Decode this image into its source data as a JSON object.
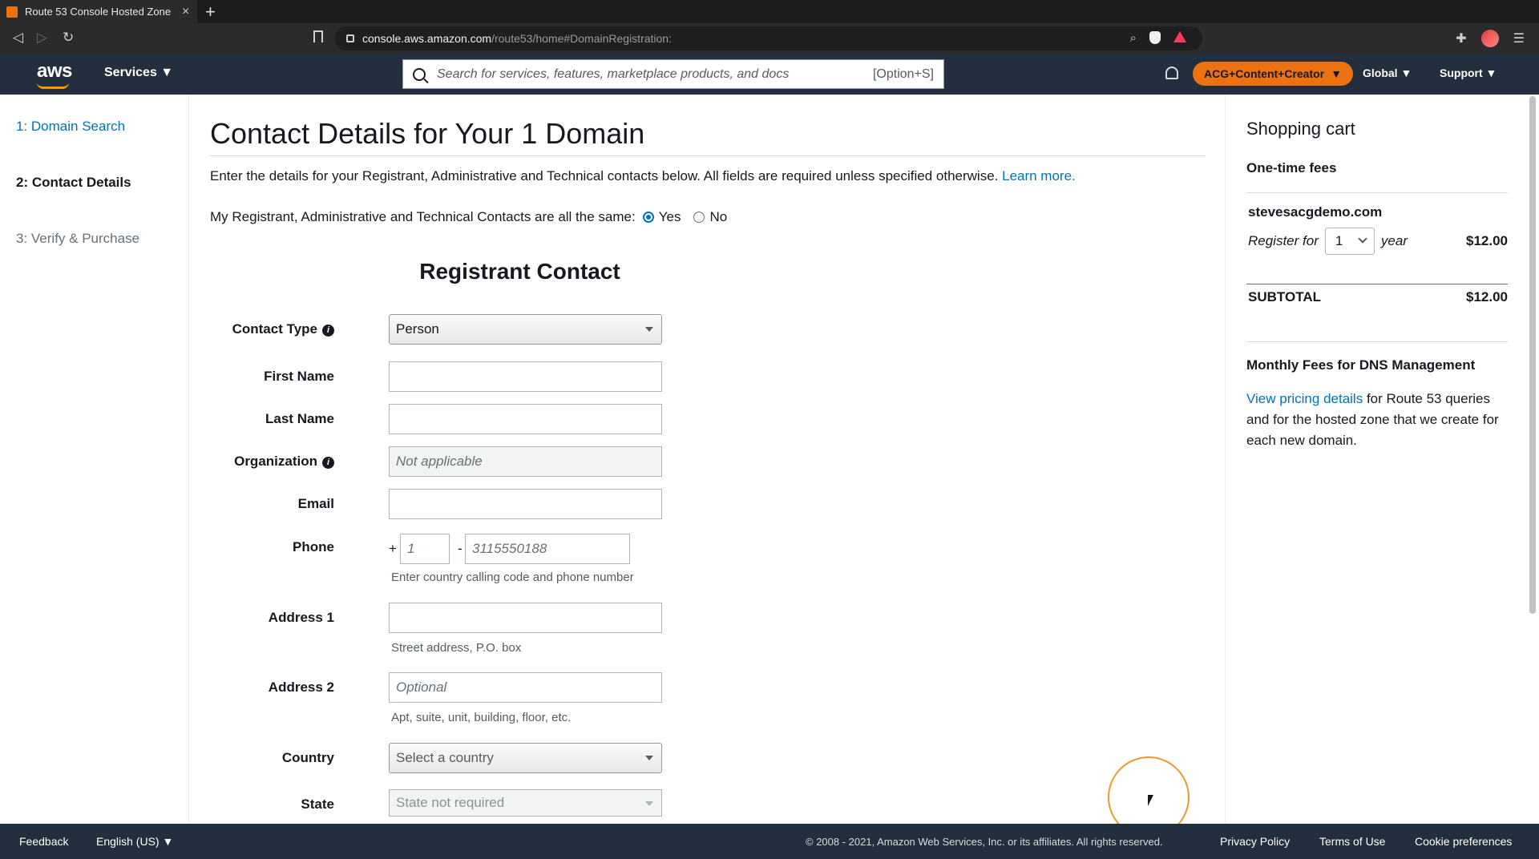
{
  "browser": {
    "tab_title": "Route 53 Console Hosted Zone",
    "url_host": "console.aws.amazon.com",
    "url_path": "/route53/home#DomainRegistration:"
  },
  "header": {
    "logo": "aws",
    "services": "Services ▼",
    "search_placeholder": "Search for services, features, marketplace products, and docs",
    "search_shortcut": "[Option+S]",
    "account": "ACG+Content+Creator",
    "region": "Global ▼",
    "support": "Support ▼"
  },
  "steps": [
    {
      "label": "1: Domain Search",
      "state": "link"
    },
    {
      "label": "2: Contact Details",
      "state": "active"
    },
    {
      "label": "3: Verify & Purchase",
      "state": "inactive"
    }
  ],
  "main": {
    "title": "Contact Details for Your 1 Domain",
    "intro": "Enter the details for your Registrant, Administrative and Technical contacts below. All fields are required unless specified otherwise.",
    "learn_more": "Learn more.",
    "same_question": "My Registrant, Administrative and Technical Contacts are all the same:",
    "yes": "Yes",
    "no": "No",
    "section_title": "Registrant Contact"
  },
  "form": {
    "contact_type_label": "Contact Type",
    "contact_type_value": "Person",
    "first_name_label": "First Name",
    "last_name_label": "Last Name",
    "organization_label": "Organization",
    "organization_placeholder": "Not applicable",
    "email_label": "Email",
    "phone_label": "Phone",
    "phone_plus": "+",
    "phone_dash": "-",
    "phone_cc_placeholder": "1",
    "phone_number_placeholder": "3115550188",
    "phone_hint": "Enter country calling code and phone number",
    "address1_label": "Address 1",
    "address1_hint": "Street address, P.O. box",
    "address2_label": "Address 2",
    "address2_placeholder": "Optional",
    "address2_hint": "Apt, suite, unit, building, floor, etc.",
    "country_label": "Country",
    "country_value": "Select a country",
    "state_label": "State",
    "state_value": "State not required"
  },
  "cart": {
    "title": "Shopping cart",
    "one_time": "One-time fees",
    "domain": "stevesacgdemo.com",
    "register_for": "Register for",
    "years": "1",
    "year_word": "year",
    "price": "$12.00",
    "subtotal_label": "SUBTOTAL",
    "subtotal_value": "$12.00",
    "monthly_title": "Monthly Fees for DNS Management",
    "pricing_link": "View pricing details",
    "monthly_text": " for Route 53 queries and for the hosted zone that we create for each new domain."
  },
  "footer": {
    "feedback": "Feedback",
    "language": "English (US) ▼",
    "copyright": "© 2008 - 2021, Amazon Web Services, Inc. or its affiliates. All rights reserved.",
    "privacy": "Privacy Policy",
    "terms": "Terms of Use",
    "cookies": "Cookie preferences"
  },
  "colors": {
    "aws_header": "#232f3e",
    "accent_orange": "#ec7211",
    "link_blue": "#0073bb"
  }
}
